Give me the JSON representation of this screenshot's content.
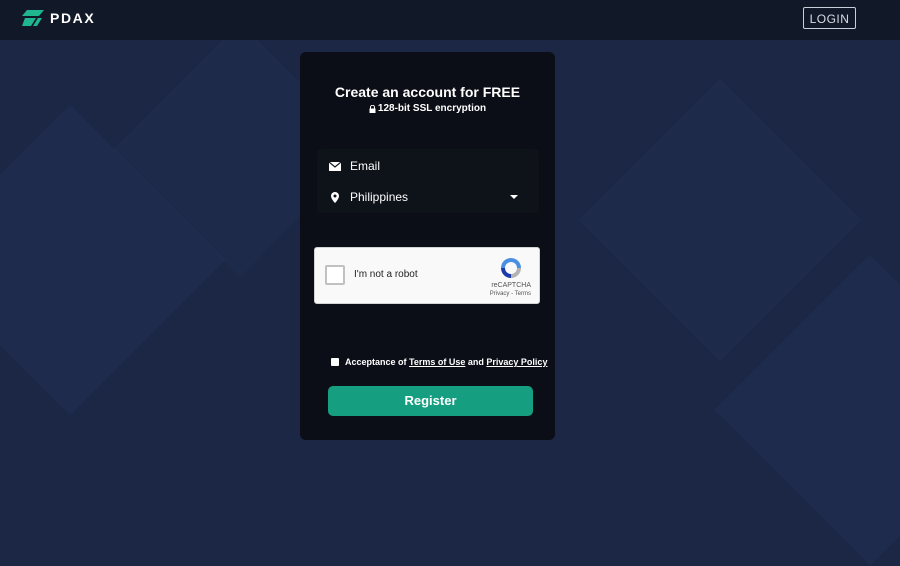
{
  "header": {
    "brand": "PDAX",
    "login_label": "LOGIN"
  },
  "form": {
    "title": "Create an account for FREE",
    "subtitle": "128-bit SSL encryption",
    "email_placeholder": "Email",
    "country_value": "Philippines",
    "captcha": {
      "label": "I'm not a robot",
      "brand": "reCAPTCHA",
      "privacy": "Privacy",
      "separator": " - ",
      "terms": "Terms"
    },
    "terms_prefix": "Acceptance of ",
    "terms_link": "Terms of Use",
    "terms_and": " and ",
    "privacy_link": "Privacy Policy",
    "register_label": "Register"
  },
  "colors": {
    "background": "#1b2745",
    "topbar": "#111828",
    "card": "#0b0e16",
    "accent": "#169e80"
  },
  "icons": {
    "logo": "pdax-logo-icon",
    "lock": "lock-icon",
    "email": "envelope-icon",
    "country": "map-pin-icon",
    "dropdown": "caret-down-icon",
    "captcha": "recaptcha-icon"
  }
}
